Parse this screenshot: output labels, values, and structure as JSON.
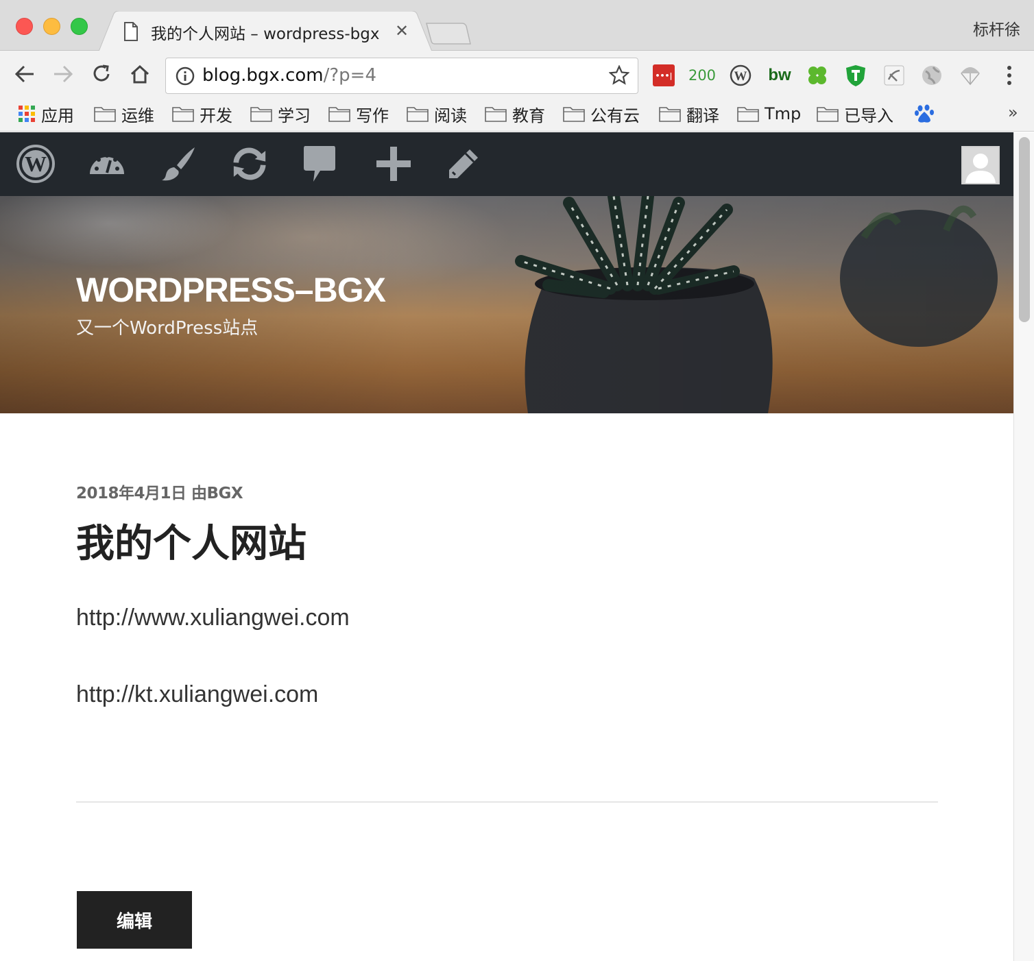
{
  "window": {
    "tab_title": "我的个人网站 – wordpress-bgx",
    "profile_name": "标杆徐"
  },
  "toolbar": {
    "url_host": "blog.bgx.com",
    "url_path": "/?p=4",
    "extensions": [
      "lastpass-icon",
      "200",
      "wordpress-icon",
      "bw",
      "clover-icon",
      "shield-t-icon",
      "youdao-icon",
      "globe-icon",
      "parachute-icon"
    ],
    "ext_200_label": "200",
    "ext_bw_label": "bw",
    "lastpass_label": "•••|"
  },
  "bookmarks": {
    "apps": "应用",
    "folders": [
      "运维",
      "开发",
      "学习",
      "写作",
      "阅读",
      "教育",
      "公有云",
      "翻译",
      "Tmp",
      "已导入"
    ],
    "more": "»"
  },
  "site": {
    "title": "WORDPRESS–BGX",
    "description": "又一个WordPress站点"
  },
  "post": {
    "meta": "2018年4月1日 由BGX",
    "title": "我的个人网站",
    "paragraphs": [
      "http://www.xuliangwei.com",
      "http://kt.xuliangwei.com"
    ],
    "edit_label": "编辑"
  },
  "colors": {
    "admin_bar": "#23282d",
    "button": "#222222"
  }
}
